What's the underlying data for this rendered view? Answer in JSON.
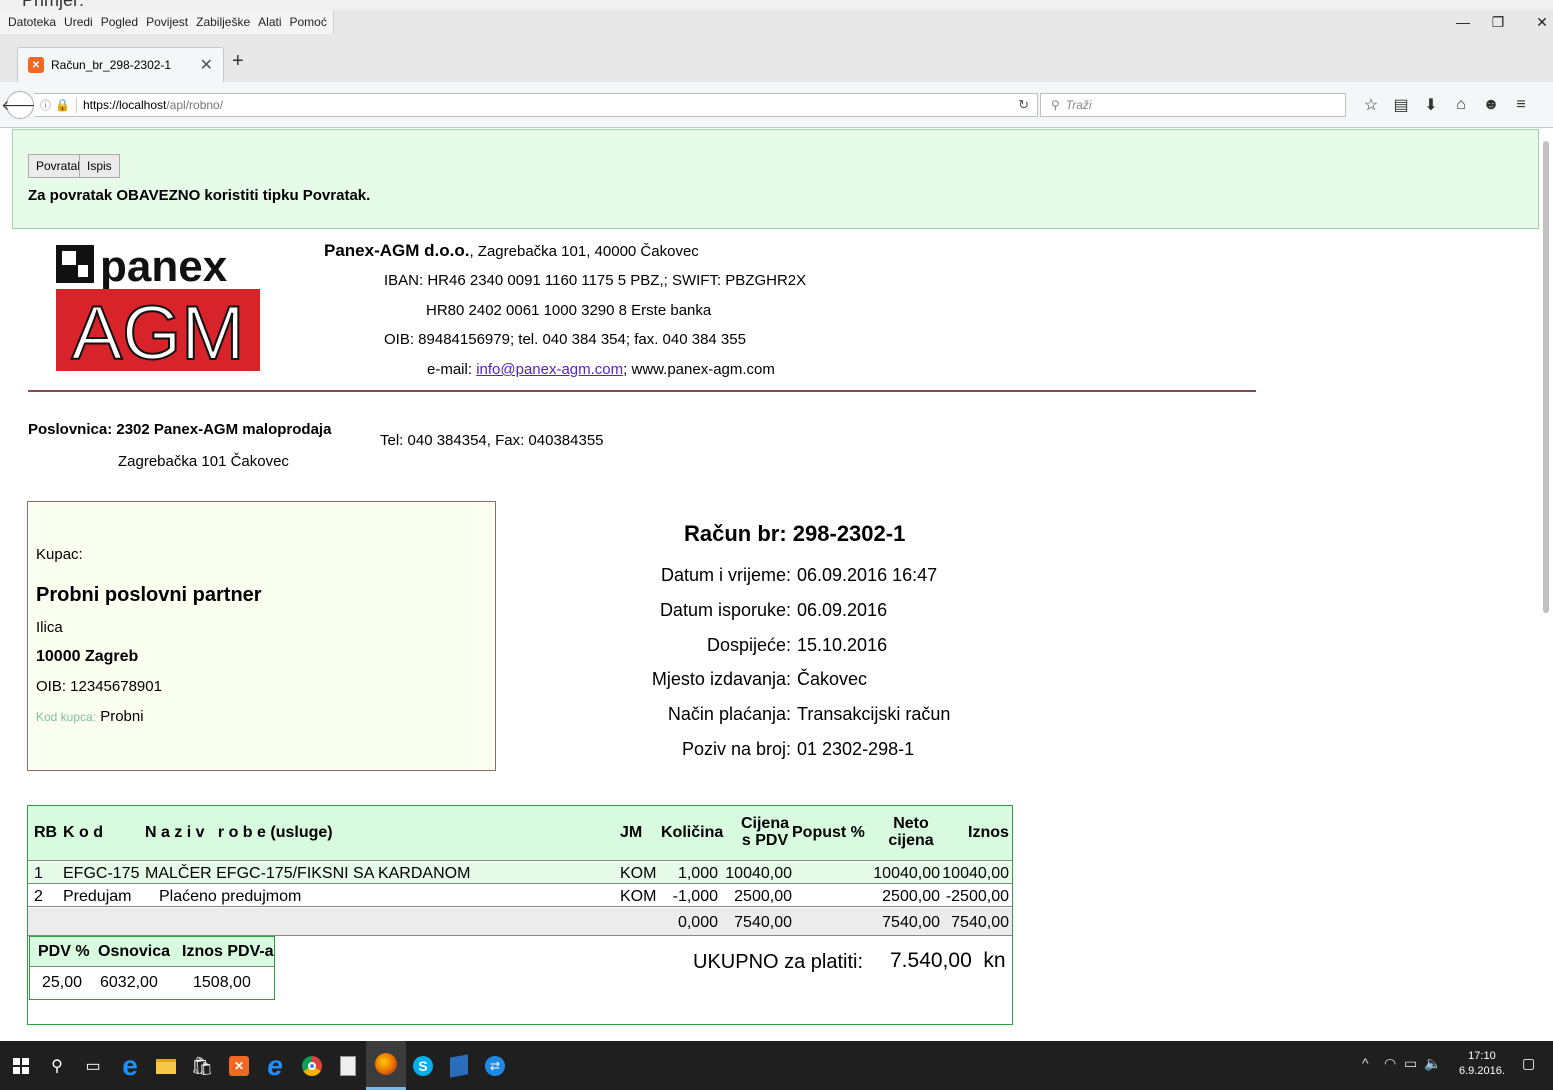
{
  "window": {
    "top_cut_text": "Primjer:",
    "menu": [
      "Datoteka",
      "Uredi",
      "Pogled",
      "Povijest",
      "Zabilješke",
      "Alati",
      "Pomoć"
    ],
    "tab_title": "Račun_br_298-2302-1",
    "url_host": "https://localhost",
    "url_path": "/apl/robno/",
    "search_placeholder": "Traži"
  },
  "page": {
    "back_button": "Povratak",
    "print_button": "Ispis",
    "warning": "Za povratak OBAVEZNO koristiti tipku Povratak.",
    "company": {
      "name": "Panex-AGM d.o.o.",
      "address": ", Zagrebačka 101, 40000 Čakovec",
      "iban": "IBAN: HR46 2340 0091 1160 1175 5 PBZ,;   SWIFT: PBZGHR2X",
      "iban2": "HR80 2402 0061 1000 3290 8 Erste banka",
      "oib_tel_fax": "OIB: 89484156979;     tel. 040 384 354;   fax. 040 384 355",
      "email_label": "e-mail: ",
      "email": "info@panex-agm.com",
      "web": ";    www.panex-agm.com",
      "logo_top": "panex",
      "logo_bottom": "AGM"
    },
    "branch": {
      "name": "Poslovnica: 2302 Panex-AGM maloprodaja",
      "address": "Zagrebačka 101   Čakovec",
      "contact": "Tel: 040 384354, Fax: 040384355"
    },
    "buyer": {
      "label": "Kupac:",
      "name": "Probni poslovni partner",
      "street": "Ilica",
      "city": "10000  Zagreb",
      "oib": "OIB: 12345678901",
      "code_label": "Kod kupca:",
      "code": " Probni"
    },
    "invoice": {
      "title": "Račun br:  298-2302-1",
      "rows": [
        {
          "label": "Datum i vrijeme:",
          "value": "06.09.2016 16:47"
        },
        {
          "label": "Datum isporuke:",
          "value": "06.09.2016"
        },
        {
          "label": "Dospijeće:",
          "value": "15.10.2016"
        },
        {
          "label": "Mjesto izdavanja:",
          "value": "Čakovec"
        },
        {
          "label": "Način plaćanja:",
          "value": "Transakcijski račun"
        },
        {
          "label": "Poziv na broj:",
          "value": "01 2302-298-1"
        }
      ]
    },
    "table": {
      "headers": {
        "rb": "RB",
        "kod": "K o d",
        "naziv": "N a z i v   r o b e (usluge)",
        "jm": "JM",
        "kolicina": "Količina",
        "cijena1": "Cijena",
        "cijena2": "s PDV",
        "popust": "Popust %",
        "neto1": "Neto",
        "neto2": "cijena",
        "iznos": "Iznos"
      },
      "rows": [
        {
          "rb": "1",
          "kod": "EFGC-175",
          "naziv": "MALČER EFGC-175/FIKSNI SA KARDANOM",
          "jm": "KOM",
          "kolicina": "1,000",
          "cijena": "10040,00",
          "popust": "",
          "neto": "10040,00",
          "iznos": "10040,00"
        },
        {
          "rb": "2",
          "kod": "Predujam",
          "naziv": "Plaćeno predujmom",
          "jm": "KOM",
          "kolicina": "-1,000",
          "cijena": "2500,00",
          "popust": "",
          "neto": "2500,00",
          "iznos": "-2500,00"
        }
      ],
      "total": {
        "kolicina": "0,000",
        "cijena": "7540,00",
        "neto": "7540,00",
        "iznos": "7540,00"
      }
    },
    "vat": {
      "headers": [
        "PDV %",
        "Osnovica",
        "Iznos PDV-a"
      ],
      "values": [
        "25,00",
        "6032,00",
        "1508,00"
      ]
    },
    "grand_total": {
      "label": "UKUPNO za platiti:",
      "value": "7.540,00  kn"
    }
  },
  "taskbar": {
    "time": "17:10",
    "date": "6.9.2016."
  }
}
